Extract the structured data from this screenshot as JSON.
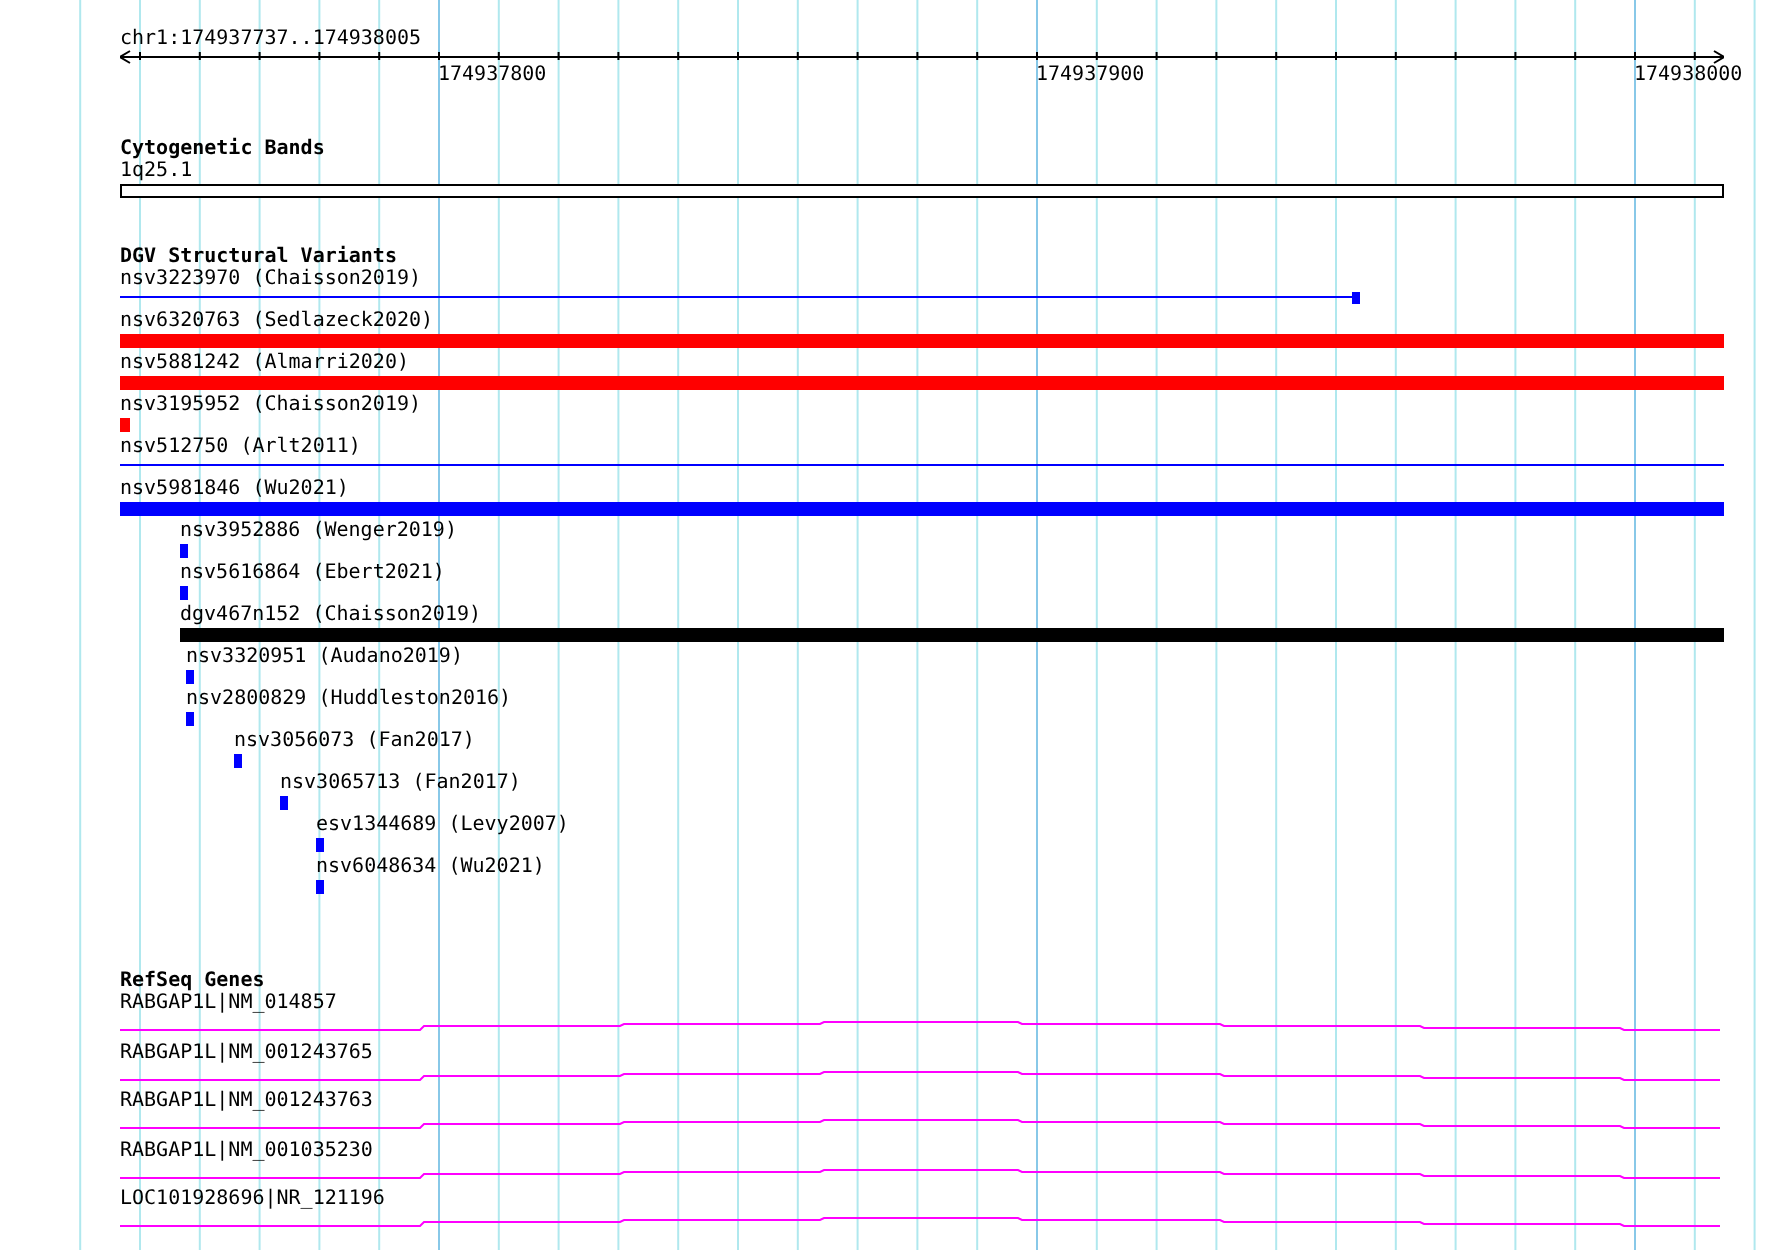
{
  "ruler": {
    "location": "chr1:174937737..174938005",
    "ticks": [
      "174937800",
      "174937900",
      "174938000"
    ]
  },
  "tracks": [
    {
      "kind": "bands",
      "title": "Cytogenetic Bands",
      "features": [
        {
          "label": "1q25.1"
        }
      ]
    },
    {
      "kind": "variants",
      "title": "DGV Structural Variants",
      "features": [
        {
          "label": "nsv3223970 (Chaisson2019)",
          "kind": "line",
          "color": "#0000ff"
        },
        {
          "label": "nsv6320763 (Sedlazeck2020)",
          "kind": "bar",
          "color": "#ff0000"
        },
        {
          "label": "nsv5881242 (Almarri2020)",
          "kind": "bar",
          "color": "#ff0000"
        },
        {
          "label": "nsv3195952 (Chaisson2019)",
          "kind": "point",
          "color": "#ff0000"
        },
        {
          "label": "nsv512750 (Arlt2011)",
          "kind": "line",
          "color": "#0000ff"
        },
        {
          "label": "nsv5981846 (Wu2021)",
          "kind": "bar",
          "color": "#0000ff"
        },
        {
          "label": "nsv3952886 (Wenger2019)",
          "kind": "point",
          "color": "#0000ff"
        },
        {
          "label": "nsv5616864 (Ebert2021)",
          "kind": "point",
          "color": "#0000ff"
        },
        {
          "label": "dgv467n152 (Chaisson2019)",
          "kind": "bar",
          "color": "#000000"
        },
        {
          "label": "nsv3320951 (Audano2019)",
          "kind": "point",
          "color": "#0000ff"
        },
        {
          "label": "nsv2800829 (Huddleston2016)",
          "kind": "point",
          "color": "#0000ff"
        },
        {
          "label": "nsv3056073 (Fan2017)",
          "kind": "point",
          "color": "#0000ff"
        },
        {
          "label": "nsv3065713 (Fan2017)",
          "kind": "point",
          "color": "#0000ff"
        },
        {
          "label": "esv1344689 (Levy2007)",
          "kind": "point",
          "color": "#0000ff"
        },
        {
          "label": "nsv6048634 (Wu2021)",
          "kind": "point",
          "color": "#0000ff"
        }
      ]
    },
    {
      "kind": "genes",
      "title": "RefSeq Genes",
      "features": [
        {
          "label": "RABGAP1L|NM_014857"
        },
        {
          "label": "RABGAP1L|NM_001243765"
        },
        {
          "label": "RABGAP1L|NM_001243763"
        },
        {
          "label": "RABGAP1L|NM_001035230"
        },
        {
          "label": "LOC101928696|NR_121196"
        }
      ]
    }
  ]
}
